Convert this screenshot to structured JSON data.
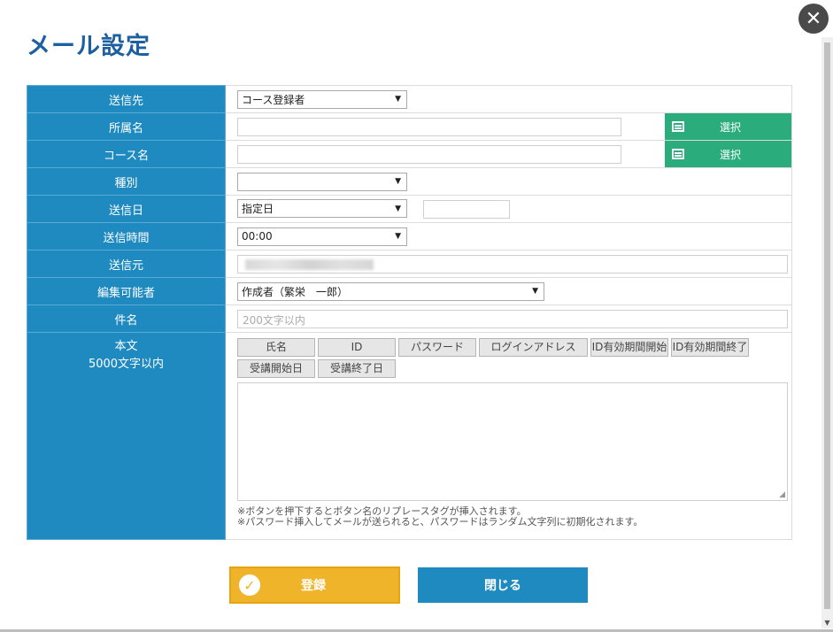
{
  "page": {
    "title": "メール設定"
  },
  "form": {
    "recipient": {
      "label": "送信先",
      "value": "コース登録者"
    },
    "affiliation": {
      "label": "所属名",
      "value": "",
      "button": "選択"
    },
    "course": {
      "label": "コース名",
      "value": "",
      "button": "選択"
    },
    "type": {
      "label": "種別",
      "value": ""
    },
    "send_date": {
      "label": "送信日",
      "value": "指定日",
      "date_value": ""
    },
    "send_time": {
      "label": "送信時間",
      "value": "00:00"
    },
    "sender": {
      "label": "送信元",
      "value": ""
    },
    "editor": {
      "label": "編集可能者",
      "value": "作成者（繁栄　一郎）"
    },
    "subject": {
      "label": "件名",
      "placeholder": "200文字以内"
    },
    "body": {
      "label": "本文",
      "sublabel": "5000文字以内",
      "tags": [
        "氏名",
        "ID",
        "パスワード",
        "ログインアドレス",
        "ID有効期間開始",
        "ID有効期間終了",
        "受講開始日",
        "受講終了日"
      ],
      "note1": "※ボタンを押下するとボタン名のリプレースタグが挿入されます。",
      "note2": "※パスワード挿入してメールが送られると、パスワードはランダム文字列に初期化されます。"
    }
  },
  "actions": {
    "submit": "登録",
    "close": "閉じる"
  },
  "colors": {
    "label_bg": "#1f8ac0",
    "pick_btn": "#2aac7d",
    "submit": "#f0b42a",
    "title": "#1e5fa0"
  }
}
